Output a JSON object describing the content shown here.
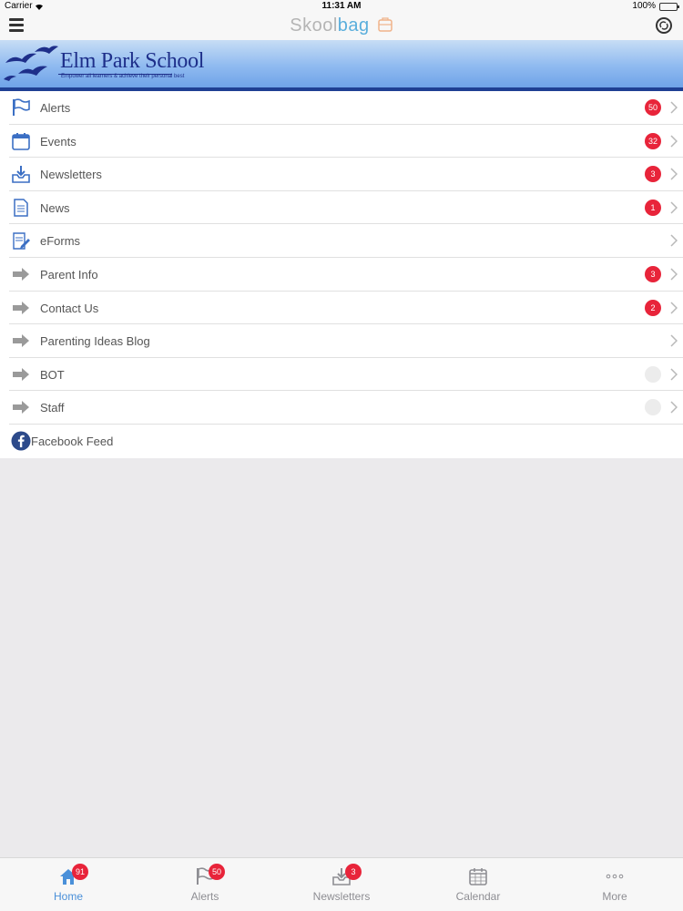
{
  "status_bar": {
    "carrier": "Carrier",
    "time": "11:31 AM",
    "battery": "100%"
  },
  "nav": {
    "title_part1": "Skool",
    "title_part2": "bag"
  },
  "banner": {
    "school_name": "Elm Park School",
    "tagline": "Empower all learners & achieve their personal best"
  },
  "menu": {
    "items": [
      {
        "label": "Alerts",
        "badge": "50",
        "icon": "flag-icon"
      },
      {
        "label": "Events",
        "badge": "32",
        "icon": "calendar-icon"
      },
      {
        "label": "Newsletters",
        "badge": "3",
        "icon": "inbox-download-icon"
      },
      {
        "label": "News",
        "badge": "1",
        "icon": "document-icon"
      },
      {
        "label": "eForms",
        "badge": "",
        "icon": "form-pencil-icon"
      },
      {
        "label": "Parent Info",
        "badge": "3",
        "icon": "arrow-right-icon"
      },
      {
        "label": "Contact Us",
        "badge": "2",
        "icon": "arrow-right-icon"
      },
      {
        "label": "Parenting Ideas Blog",
        "badge": "",
        "icon": "arrow-right-icon"
      },
      {
        "label": "BOT",
        "badge": "",
        "icon": "arrow-right-icon"
      },
      {
        "label": "Staff",
        "badge": "",
        "icon": "arrow-right-icon"
      },
      {
        "label": "Facebook Feed",
        "badge": "",
        "icon": "facebook-icon"
      }
    ]
  },
  "tabbar": {
    "tabs": [
      {
        "label": "Home",
        "badge": "91",
        "icon": "home-icon",
        "active": true
      },
      {
        "label": "Alerts",
        "badge": "50",
        "icon": "flag-icon",
        "active": false
      },
      {
        "label": "Newsletters",
        "badge": "3",
        "icon": "inbox-download-icon",
        "active": false
      },
      {
        "label": "Calendar",
        "badge": "",
        "icon": "calendar-icon",
        "active": false
      },
      {
        "label": "More",
        "badge": "",
        "icon": "more-dots-icon",
        "active": false
      }
    ]
  },
  "colors": {
    "accent": "#4a90d9",
    "badge": "#e8243a",
    "banner_dark": "#1e2f8a"
  }
}
